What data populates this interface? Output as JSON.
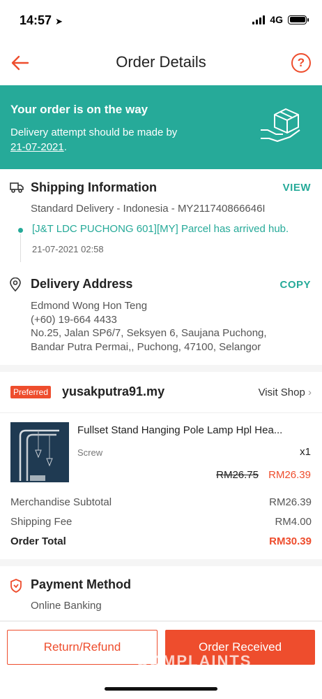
{
  "status_bar": {
    "time": "14:57",
    "network": "4G"
  },
  "header": {
    "title": "Order Details",
    "help_label": "?"
  },
  "banner": {
    "title": "Your order is on the way",
    "subtitle": "Delivery attempt should be made by",
    "date": "21-07-2021",
    "date_suffix": "."
  },
  "shipping": {
    "title": "Shipping Information",
    "action": "VIEW",
    "method": "Standard Delivery - Indonesia - MY211740866646I",
    "tracking_message": "[J&T LDC PUCHONG 601][MY] Parcel has arrived hub.",
    "tracking_time": "21-07-2021 02:58"
  },
  "address": {
    "title": "Delivery Address",
    "action": "COPY",
    "name": "Edmond Wong Hon Teng",
    "phone": "(+60) 19-664 4433",
    "line1": "No.25, Jalan SP6/7, Seksyen 6, Saujana Puchong,",
    "line2": "Bandar Putra Permai,, Puchong, 47100, Selangor"
  },
  "shop": {
    "badge": "Preferred",
    "name": "yusakputra91.my",
    "visit_label": "Visit Shop",
    "product": {
      "name": "Fullset Stand Hanging Pole Lamp Hpl Hea...",
      "variant": "Screw",
      "quantity": "x1",
      "price_original": "RM26.75",
      "price_current": "RM26.39"
    },
    "summary": {
      "subtotal_label": "Merchandise Subtotal",
      "subtotal_value": "RM26.39",
      "shipping_label": "Shipping Fee",
      "shipping_value": "RM4.00",
      "total_label": "Order Total",
      "total_value": "RM30.39"
    }
  },
  "payment": {
    "title": "Payment Method",
    "method": "Online Banking"
  },
  "actions": {
    "refund_label": "Return/Refund",
    "received_label": "Order Received"
  },
  "watermark": "COMPLAINTS",
  "colors": {
    "primary": "#ee4d2d",
    "teal": "#26aa99",
    "divider": "#f5f5f5"
  }
}
